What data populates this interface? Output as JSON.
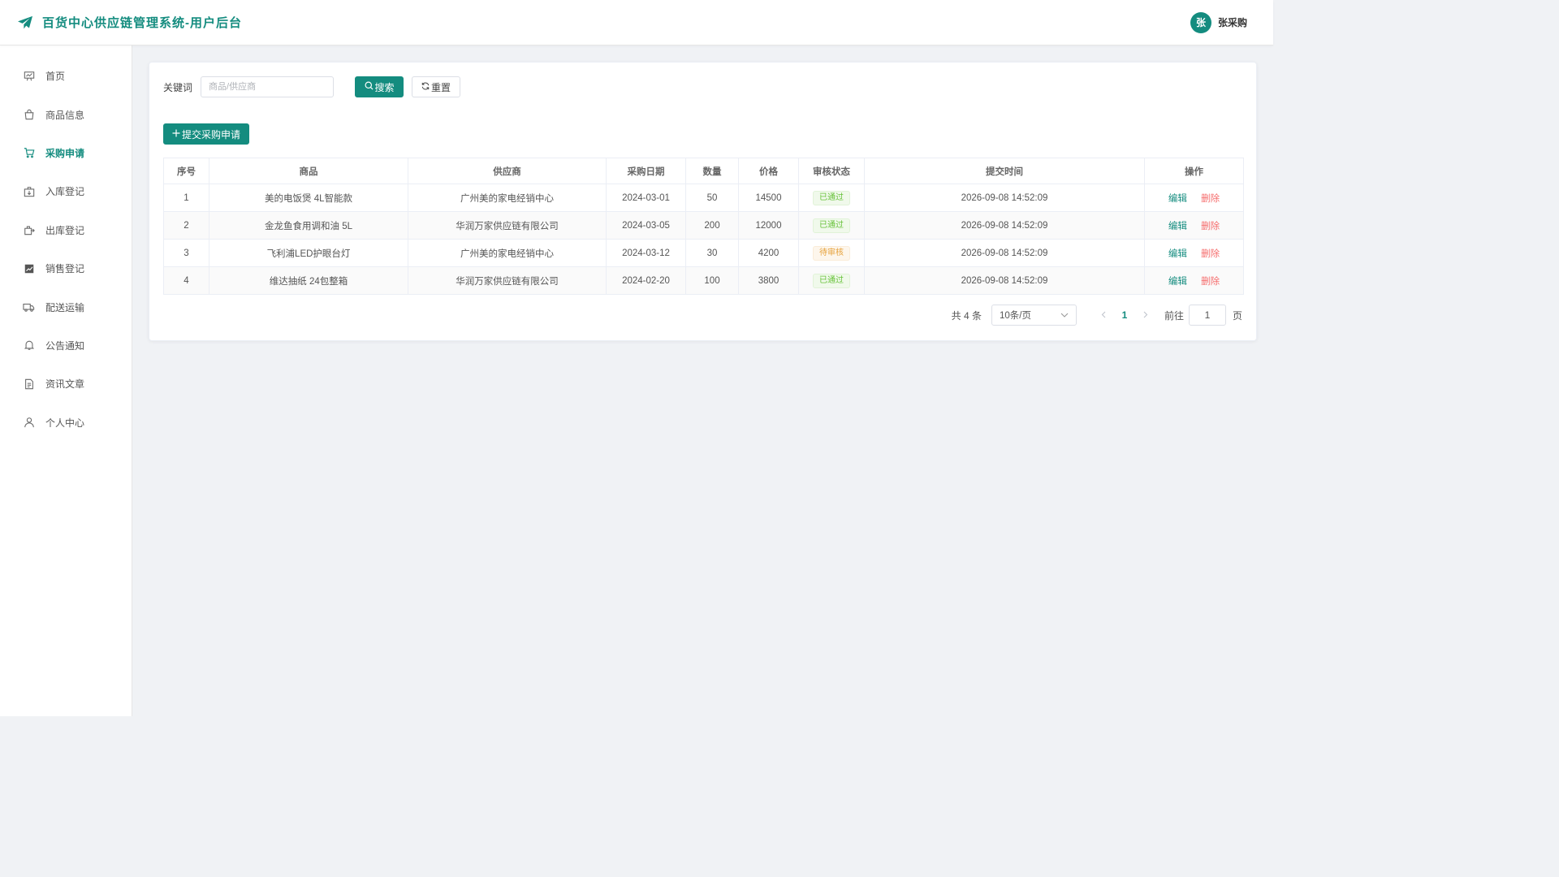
{
  "header": {
    "title": "百货中心供应链管理系统-用户后台",
    "user_avatar_text": "张",
    "user_name": "张采购",
    "brand_color": "#148c7f"
  },
  "sidebar": {
    "items": [
      {
        "label": "首页",
        "icon": "presentation-icon",
        "active": false
      },
      {
        "label": "商品信息",
        "icon": "shopping-bag-icon",
        "active": false
      },
      {
        "label": "采购申请",
        "icon": "shopping-cart-icon",
        "active": true
      },
      {
        "label": "入库登记",
        "icon": "box-in-icon",
        "active": false
      },
      {
        "label": "出库登记",
        "icon": "box-out-icon",
        "active": false
      },
      {
        "label": "销售登记",
        "icon": "trend-chart-icon",
        "active": false
      },
      {
        "label": "配送运输",
        "icon": "truck-icon",
        "active": false
      },
      {
        "label": "公告通知",
        "icon": "bell-icon",
        "active": false
      },
      {
        "label": "资讯文章",
        "icon": "document-icon",
        "active": false
      },
      {
        "label": "个人中心",
        "icon": "user-icon",
        "active": false
      }
    ]
  },
  "search": {
    "label": "关键词",
    "placeholder": "商品/供应商",
    "value": "",
    "search_button": "搜索",
    "reset_button": "重置"
  },
  "toolbar": {
    "add_button": "提交采购申请"
  },
  "table": {
    "columns": [
      "序号",
      "商品",
      "供应商",
      "采购日期",
      "数量",
      "价格",
      "审核状态",
      "提交时间",
      "操作"
    ],
    "rows": [
      {
        "index": "1",
        "product": "美的电饭煲 4L智能款",
        "supplier": "广州美的家电经销中心",
        "date": "2024-03-01",
        "qty": "50",
        "price": "14500",
        "status": "已通过",
        "status_type": "ok",
        "submitted": "2026-09-08 14:52:09",
        "edit": "编辑",
        "delete": "删除"
      },
      {
        "index": "2",
        "product": "金龙鱼食用调和油 5L",
        "supplier": "华润万家供应链有限公司",
        "date": "2024-03-05",
        "qty": "200",
        "price": "12000",
        "status": "已通过",
        "status_type": "ok",
        "submitted": "2026-09-08 14:52:09",
        "edit": "编辑",
        "delete": "删除"
      },
      {
        "index": "3",
        "product": "飞利浦LED护眼台灯",
        "supplier": "广州美的家电经销中心",
        "date": "2024-03-12",
        "qty": "30",
        "price": "4200",
        "status": "待审核",
        "status_type": "wait",
        "submitted": "2026-09-08 14:52:09",
        "edit": "编辑",
        "delete": "删除"
      },
      {
        "index": "4",
        "product": "维达抽纸 24包整箱",
        "supplier": "华润万家供应链有限公司",
        "date": "2024-02-20",
        "qty": "100",
        "price": "3800",
        "status": "已通过",
        "status_type": "ok",
        "submitted": "2026-09-08 14:52:09",
        "edit": "编辑",
        "delete": "删除"
      }
    ]
  },
  "pagination": {
    "total_text": "共 4 条",
    "page_size": "10条/页",
    "current_page": "1",
    "goto_label": "前往",
    "goto_value": "1",
    "page_suffix": "页"
  }
}
